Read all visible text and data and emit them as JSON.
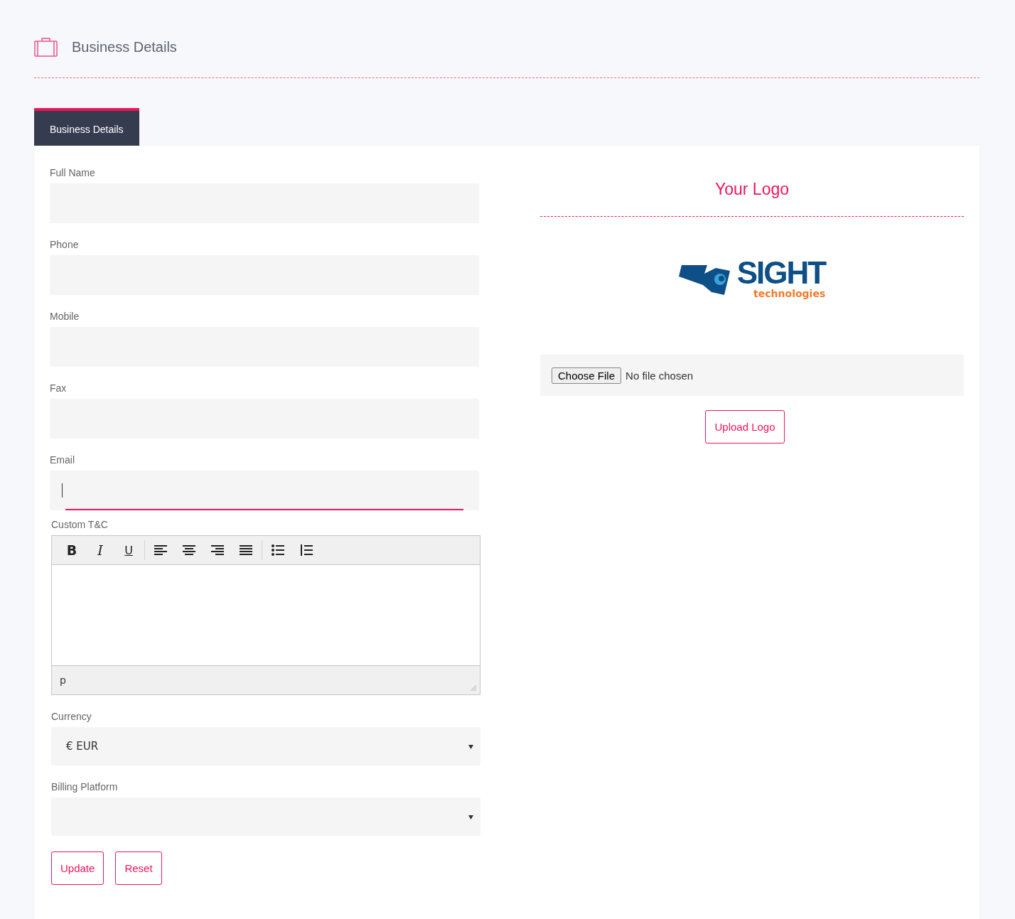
{
  "page_title": "Business Details",
  "tabs": [
    {
      "label": "Business Details",
      "selected": true
    }
  ],
  "fields": [
    {
      "label": "Full Name",
      "focused": false
    },
    {
      "label": "Phone",
      "focused": false
    },
    {
      "label": "Mobile",
      "focused": false
    },
    {
      "label": "Fax",
      "focused": false
    },
    {
      "label": "Email",
      "focused": true
    }
  ],
  "editor": {
    "label": "Custom T&C",
    "toolbar": [
      [
        {
          "kind": "bold",
          "label": "B"
        },
        {
          "kind": "italic",
          "label": "I"
        },
        {
          "kind": "underline",
          "label": "U"
        }
      ],
      [
        {
          "kind": "align-left"
        },
        {
          "kind": "align-center"
        },
        {
          "kind": "align-right"
        },
        {
          "kind": "justify"
        }
      ],
      [
        {
          "kind": "bullet-list"
        },
        {
          "kind": "numbered-list"
        }
      ]
    ],
    "path": "p"
  },
  "selects": [
    {
      "label": "Currency",
      "value": "€ EUR"
    },
    {
      "label": "Billing Platform"
    }
  ],
  "buttons": [
    "Update",
    "Reset"
  ],
  "logo_panel": {
    "title": "Your Logo",
    "logo_name": "SIGHT",
    "logo_tagline": "technologies",
    "file_button": "Choose File",
    "file_status": "No file chosen",
    "upload_button": "Upload Logo"
  }
}
